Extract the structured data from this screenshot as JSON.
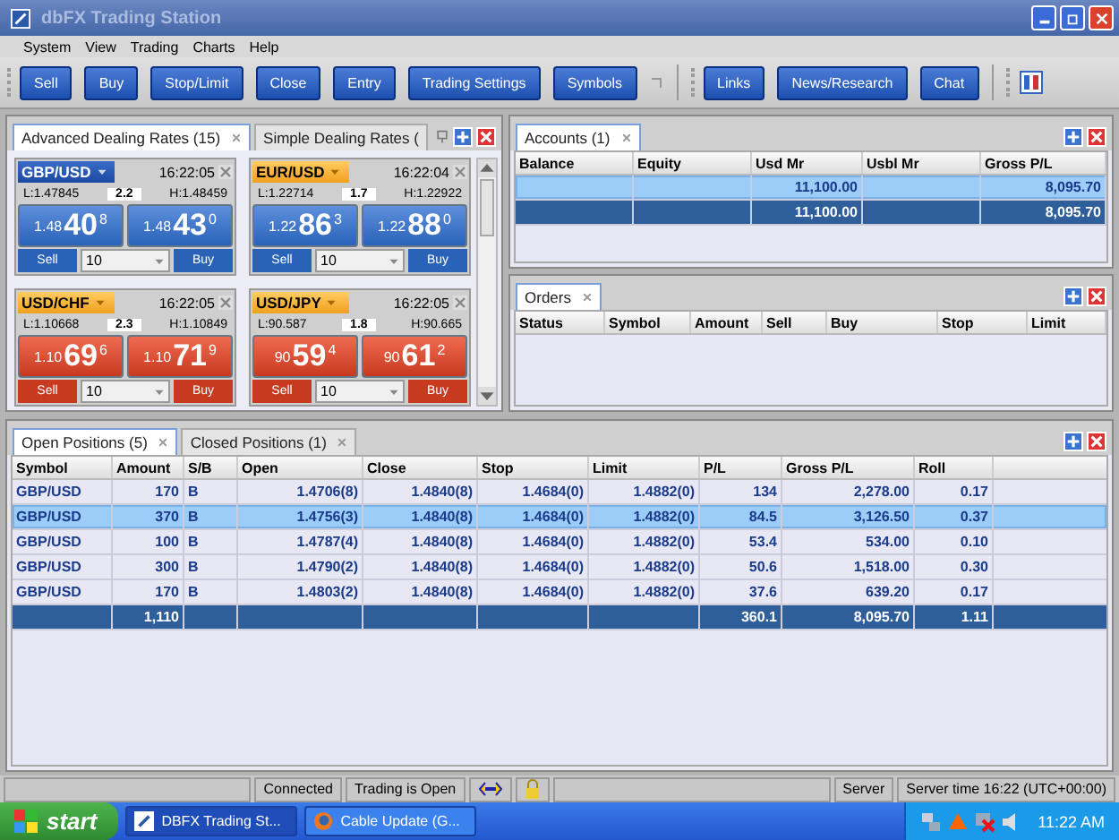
{
  "window": {
    "title": "dbFX Trading Station"
  },
  "menu": [
    "System",
    "View",
    "Trading",
    "Charts",
    "Help"
  ],
  "toolbar": {
    "left": [
      "Sell",
      "Buy",
      "Stop/Limit",
      "Close",
      "Entry",
      "Trading Settings",
      "Symbols"
    ],
    "right": [
      "Links",
      "News/Research",
      "Chat"
    ]
  },
  "rates_panel": {
    "tabs": [
      {
        "label": "Advanced Dealing Rates (15)",
        "selected": true
      },
      {
        "label": "Simple Dealing Rates (",
        "selected": false
      }
    ],
    "cards": [
      {
        "pair": "GBP/USD",
        "selected": true,
        "kind": "up",
        "time": "16:22:05",
        "low": "L:1.47845",
        "spread": "2.2",
        "high": "H:1.48459",
        "sell": {
          "prefix": "1.48",
          "big": "40",
          "pip": "8",
          "label": "Sell"
        },
        "buy": {
          "prefix": "1.48",
          "big": "43",
          "pip": "0",
          "label": "Buy"
        },
        "amount": "10"
      },
      {
        "pair": "EUR/USD",
        "selected": false,
        "kind": "up",
        "time": "16:22:04",
        "low": "L:1.22714",
        "spread": "1.7",
        "high": "H:1.22922",
        "sell": {
          "prefix": "1.22",
          "big": "86",
          "pip": "3",
          "label": "Sell"
        },
        "buy": {
          "prefix": "1.22",
          "big": "88",
          "pip": "0",
          "label": "Buy"
        },
        "amount": "10"
      },
      {
        "pair": "USD/CHF",
        "selected": false,
        "kind": "down",
        "time": "16:22:05",
        "low": "L:1.10668",
        "spread": "2.3",
        "high": "H:1.10849",
        "sell": {
          "prefix": "1.10",
          "big": "69",
          "pip": "6",
          "label": "Sell"
        },
        "buy": {
          "prefix": "1.10",
          "big": "71",
          "pip": "9",
          "label": "Buy"
        },
        "amount": "10"
      },
      {
        "pair": "USD/JPY",
        "selected": false,
        "kind": "down",
        "time": "16:22:05",
        "low": "L:90.587",
        "spread": "1.8",
        "high": "H:90.665",
        "sell": {
          "prefix": "90",
          "big": "59",
          "pip": "4",
          "label": "Sell"
        },
        "buy": {
          "prefix": "90",
          "big": "61",
          "pip": "2",
          "label": "Buy"
        },
        "amount": "10"
      }
    ]
  },
  "accounts": {
    "tab": "Accounts (1)",
    "columns": [
      "Balance",
      "Equity",
      "Usd Mr",
      "Usbl Mr",
      "Gross P/L"
    ],
    "rows": [
      {
        "highlighted": true,
        "selected": false,
        "cells": [
          null,
          null,
          "11,100.00",
          null,
          "8,095.70"
        ]
      },
      {
        "highlighted": false,
        "selected": true,
        "cells": [
          null,
          null,
          "11,100.00",
          null,
          "8,095.70"
        ]
      }
    ]
  },
  "orders": {
    "tab": "Orders",
    "columns": [
      "Status",
      "Symbol",
      "Amount",
      "Sell",
      "Buy",
      "Stop",
      "Limit"
    ]
  },
  "positions": {
    "tabs": [
      {
        "label": "Open Positions (5)",
        "selected": true
      },
      {
        "label": "Closed Positions (1)",
        "selected": false
      }
    ],
    "columns": [
      "Symbol",
      "Amount",
      "S/B",
      "Open",
      "Close",
      "Stop",
      "Limit",
      "P/L",
      "Gross P/L",
      "Roll"
    ],
    "rows": [
      {
        "selected": false,
        "cells": [
          "GBP/USD",
          "170",
          "B",
          "1.4706(8)",
          "1.4840(8)",
          "1.4684(0)",
          "1.4882(0)",
          "134",
          "2,278.00",
          "0.17"
        ]
      },
      {
        "selected": true,
        "cells": [
          "GBP/USD",
          "370",
          "B",
          "1.4756(3)",
          "1.4840(8)",
          "1.4684(0)",
          "1.4882(0)",
          "84.5",
          "3,126.50",
          "0.37"
        ]
      },
      {
        "selected": false,
        "cells": [
          "GBP/USD",
          "100",
          "B",
          "1.4787(4)",
          "1.4840(8)",
          "1.4684(0)",
          "1.4882(0)",
          "53.4",
          "534.00",
          "0.10"
        ]
      },
      {
        "selected": false,
        "cells": [
          "GBP/USD",
          "300",
          "B",
          "1.4790(2)",
          "1.4840(8)",
          "1.4684(0)",
          "1.4882(0)",
          "50.6",
          "1,518.00",
          "0.30"
        ]
      },
      {
        "selected": false,
        "cells": [
          "GBP/USD",
          "170",
          "B",
          "1.4803(2)",
          "1.4840(8)",
          "1.4684(0)",
          "1.4882(0)",
          "37.6",
          "639.20",
          "0.17"
        ]
      }
    ],
    "totals": {
      "amount": "1,110",
      "pl": "360.1",
      "gross_pl": "8,095.70",
      "roll": "1.11"
    }
  },
  "status_bar": {
    "connection": "Connected",
    "trading": "Trading is Open",
    "server": "Server",
    "server_time": "Server time 16:22 (UTC+00:00)"
  },
  "taskbar": {
    "start": "start",
    "tasks": [
      {
        "label": "DBFX Trading St...",
        "selected": true
      },
      {
        "label": "Cable Update (G...",
        "selected": false
      }
    ],
    "clock": "11:22 AM"
  }
}
